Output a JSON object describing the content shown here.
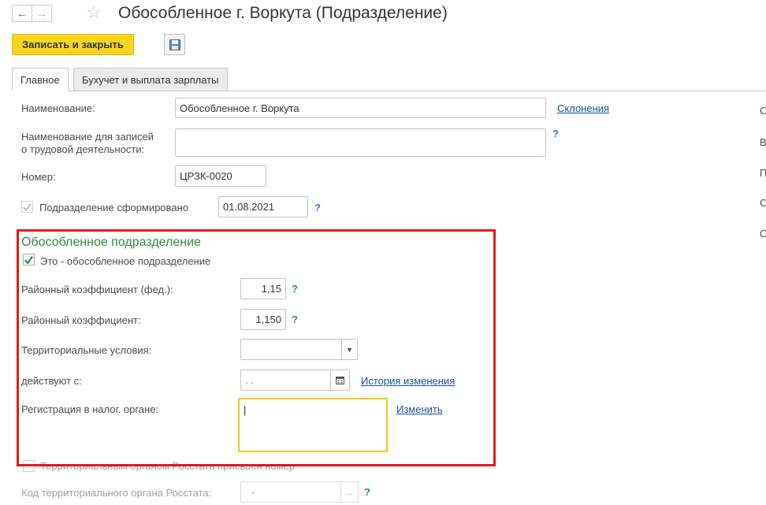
{
  "window": {
    "title": "Обособленное г. Воркута (Подразделение)"
  },
  "toolbar": {
    "save_close_label": "Записать и закрыть"
  },
  "tabs": [
    {
      "label": "Главное"
    },
    {
      "label": "Бухучет и выплата зарплаты"
    }
  ],
  "form": {
    "name_label": "Наименование:",
    "name_value": "Обособленное г. Воркута",
    "declensions_link": "Склонения",
    "labor_name_label_line1": "Наименование для записей",
    "labor_name_label_line2": "о трудовой деятельности:",
    "labor_name_value": "",
    "help": "?",
    "number_label": "Номер:",
    "number_value": "ЦРЗК-0020",
    "formed_label": "Подразделение сформировано",
    "formed_date": "01.08.2021"
  },
  "separate": {
    "title": "Обособленное подразделение",
    "is_separate_label": "Это - обособленное подразделение",
    "coef_fed_label": "Районный коэффициент (фед.):",
    "coef_fed_value": "1,15",
    "coef_label": "Районный коэффициент:",
    "coef_value": "1,150",
    "territorial_label": "Территориальные условия:",
    "territorial_value": "",
    "effective_label": "действуют с:",
    "effective_value": " .  .",
    "history_link": "История изменения",
    "tax_reg_label": "Регистрация в налог. органе:",
    "tax_reg_value": "|",
    "change_link": "Изменить"
  },
  "rosstat": {
    "assigned_label": "Территориальным органом Росстата присвоен номер",
    "code_label": "Код территориального органа Росстата:",
    "code_value": "-",
    "select_label": "..."
  },
  "right_column": [
    "С",
    "В",
    "П",
    "С",
    "С"
  ],
  "colors": {
    "primary_button": "#f7d61e",
    "section_title": "#2e8b3a",
    "highlight_frame": "#e11b1b",
    "link": "#1c4e9e",
    "focus_border": "#f0c419"
  }
}
